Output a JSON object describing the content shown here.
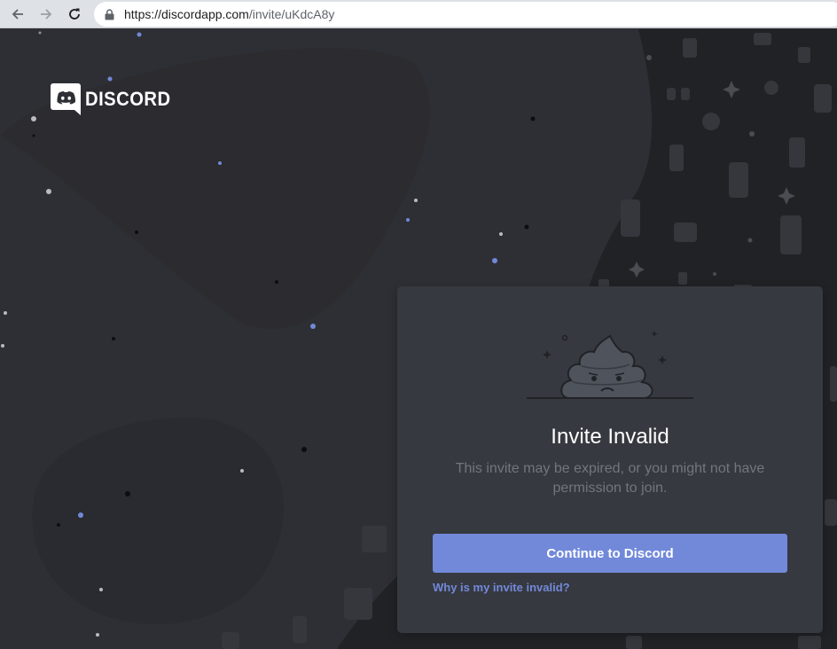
{
  "browser": {
    "url_host": "https://discordapp.com",
    "url_path": "/invite/uKdcA8y"
  },
  "logo": {
    "text": "DISCORD"
  },
  "card": {
    "title": "Invite Invalid",
    "description": "This invite may be expired, or you might not have permission to join.",
    "continue_label": "Continue to Discord",
    "help_link": "Why is my invite invalid?"
  },
  "colors": {
    "blurple": "#7289da",
    "card_bg": "#36393f",
    "page_bg": "#2e2f34",
    "muted_text": "#72767d"
  }
}
